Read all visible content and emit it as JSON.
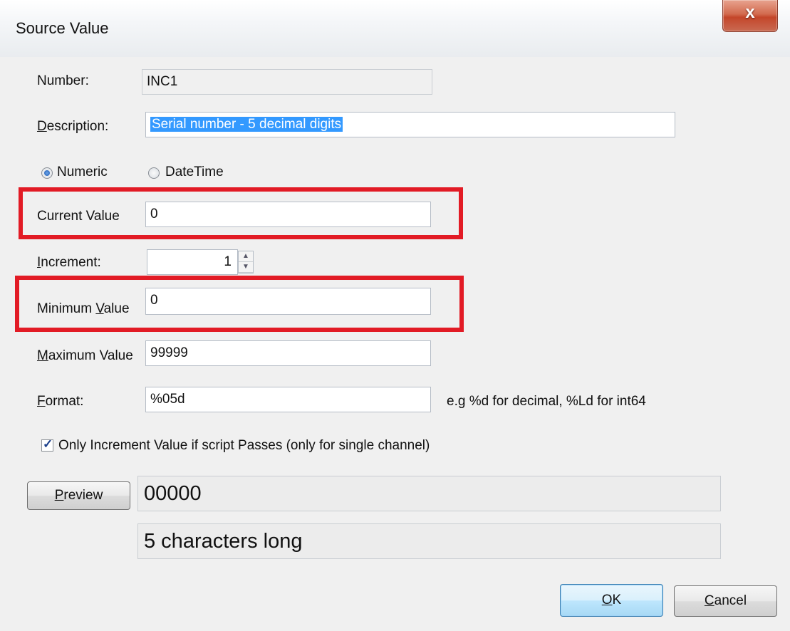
{
  "window": {
    "title": "Source Value",
    "close_glyph": "x"
  },
  "form": {
    "number": {
      "label": "Number:",
      "value": "INC1"
    },
    "description": {
      "label_pre": "",
      "label_u": "D",
      "label_post": "escription:",
      "value": "Serial number - 5 decimal digits"
    },
    "mode": {
      "numeric_label": "Numeric",
      "datetime_label": "DateTime",
      "selected": "Numeric"
    },
    "current_value": {
      "label": "Current Value",
      "value": "0"
    },
    "increment": {
      "label_u": "I",
      "label_post": "ncrement:",
      "value": "1"
    },
    "minimum_value": {
      "label_pre": "Minimum ",
      "label_u": "V",
      "label_post": "alue",
      "value": "0"
    },
    "maximum_value": {
      "label_u": "M",
      "label_post": "aximum Value",
      "value": "99999"
    },
    "format": {
      "label_u": "F",
      "label_post": "ormat:",
      "value": "%05d",
      "hint": "e.g %d for decimal, %Ld for int64"
    },
    "only_increment": {
      "label": "Only Increment Value if script Passes (only for single channel)",
      "checked": true
    }
  },
  "preview": {
    "button_u": "P",
    "button_post": "review",
    "output": "00000",
    "length_text": "5 characters long"
  },
  "buttons": {
    "ok_u": "O",
    "ok_post": "K",
    "cancel_u": "C",
    "cancel_post": "ancel"
  },
  "colors": {
    "highlight": "#e21b25",
    "selection": "#3399ff"
  }
}
